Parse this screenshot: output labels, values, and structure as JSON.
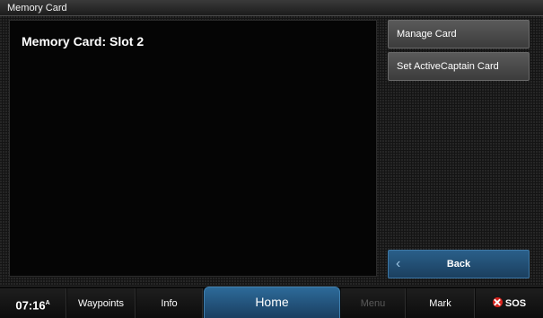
{
  "window": {
    "title": "Memory Card"
  },
  "panel": {
    "title": "Memory Card: Slot 2"
  },
  "side_buttons": {
    "manage_card": "Manage Card",
    "set_activecaptain": "Set ActiveCaptain Card",
    "back": "Back"
  },
  "bottom_bar": {
    "time": "07:16",
    "time_suffix": "A",
    "waypoints": "Waypoints",
    "info": "Info",
    "home": "Home",
    "menu": "Menu",
    "mark": "Mark",
    "sos": "SOS"
  },
  "colors": {
    "accent_blue": "#2a5f89",
    "sos_red": "#d8241e",
    "disabled_text": "#5a5a5a"
  },
  "icons": {
    "back": "chevron-left-icon",
    "sos": "sos-icon"
  }
}
